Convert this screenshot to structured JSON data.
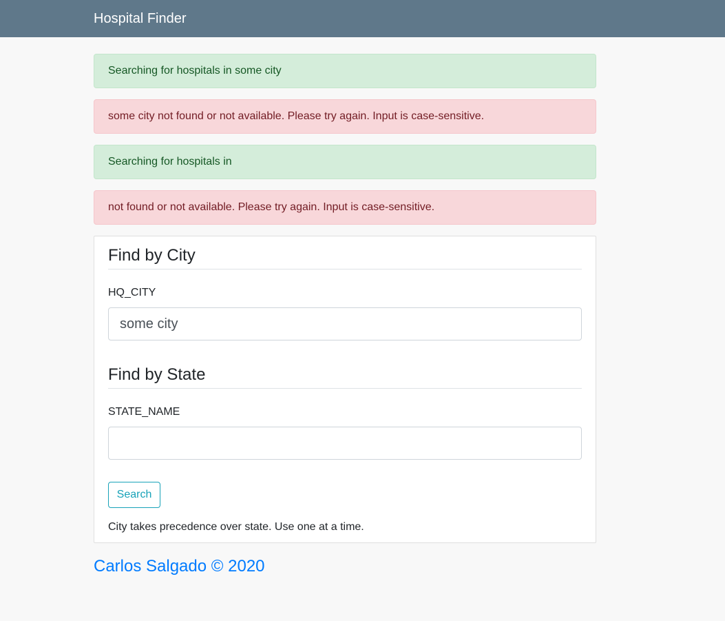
{
  "navbar": {
    "brand": "Hospital Finder"
  },
  "alerts": [
    {
      "type": "success",
      "text": "Searching for hospitals in some city"
    },
    {
      "type": "danger",
      "text": "some city not found or not available. Please try again. Input is case-sensitive."
    },
    {
      "type": "success",
      "text": "Searching for hospitals in"
    },
    {
      "type": "danger",
      "text": "not found or not available. Please try again. Input is case-sensitive."
    }
  ],
  "form": {
    "city_section_title": "Find by City",
    "city_label": "HQ_CITY",
    "city_value": "some city",
    "state_section_title": "Find by State",
    "state_label": "STATE_NAME",
    "state_value": "",
    "search_button": "Search",
    "help_text": "City takes precedence over state. Use one at a time."
  },
  "footer": {
    "text": "Carlos Salgado © 2020"
  },
  "colors": {
    "navbar": "#5f788a",
    "success_bg": "#d4edda",
    "danger_bg": "#f8d7da",
    "button_accent": "#17a2b8",
    "footer_link": "#007bff"
  }
}
